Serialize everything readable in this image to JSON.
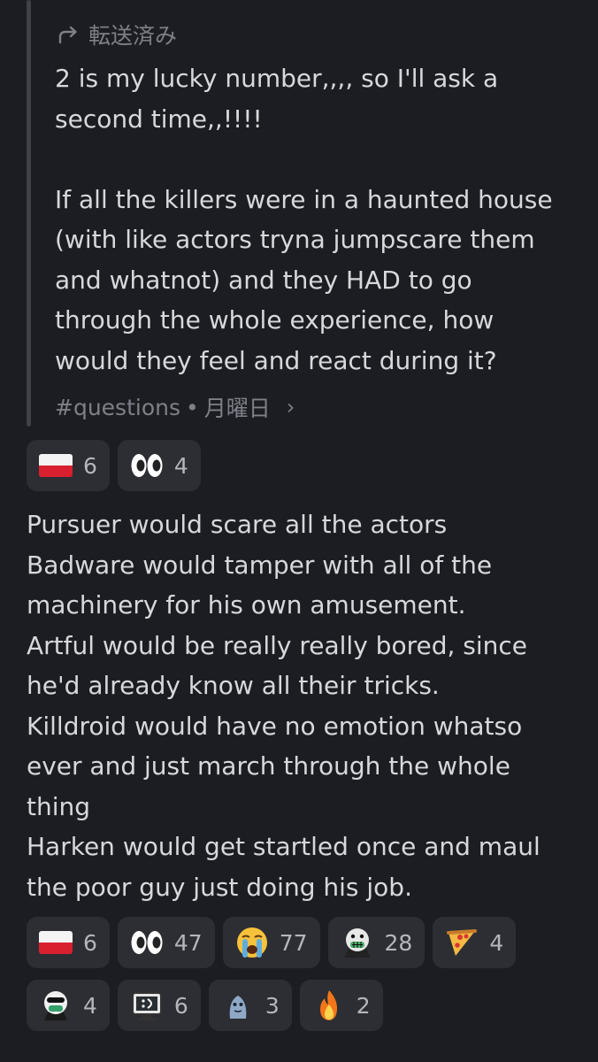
{
  "forwarded_label": "転送済み",
  "quoted_message": {
    "lines": [
      "2 is my lucky number,,,, so I'll ask a",
      "second time,,!!!!",
      "",
      "If all the killers were in a haunted house",
      "(with like actors tryna jumpscare them",
      "and whatnot) and they HAD to go",
      "through the whole experience, how",
      "would they feel and react during it?"
    ],
    "channel": "#questions",
    "separator": "•",
    "day": "月曜日",
    "chevron": "›"
  },
  "quoted_reactions": [
    {
      "emoji": "poland-flag",
      "count": "6"
    },
    {
      "emoji": "eyes",
      "count": "4"
    }
  ],
  "reply_lines": [
    "Pursuer would scare all the actors",
    "Badware would tamper with all of the",
    "machinery for his own amusement.",
    "Artful would be really really bored, since",
    "he'd already know all their tricks.",
    "Killdroid would have no emotion whatso",
    "ever and just march through the whole",
    "thing",
    "Harken would get startled once and maul",
    "the poor guy just doing his job."
  ],
  "reply_reactions": [
    {
      "emoji": "poland-flag",
      "count": "6"
    },
    {
      "emoji": "eyes",
      "count": "47"
    },
    {
      "emoji": "loudly-crying-face",
      "count": "77"
    },
    {
      "emoji": "grinning-character",
      "count": "28"
    },
    {
      "emoji": "pizza",
      "count": "4"
    },
    {
      "emoji": "masked-character",
      "count": "4"
    },
    {
      "emoji": "computer-character",
      "count": "6"
    },
    {
      "emoji": "blue-creature",
      "count": "3"
    },
    {
      "emoji": "fire",
      "count": "2"
    }
  ],
  "colors": {
    "background": "#1c1d22",
    "reaction_bg": "#2c2e33",
    "muted_text": "#7d8089",
    "body_text": "#d7d8dc"
  }
}
